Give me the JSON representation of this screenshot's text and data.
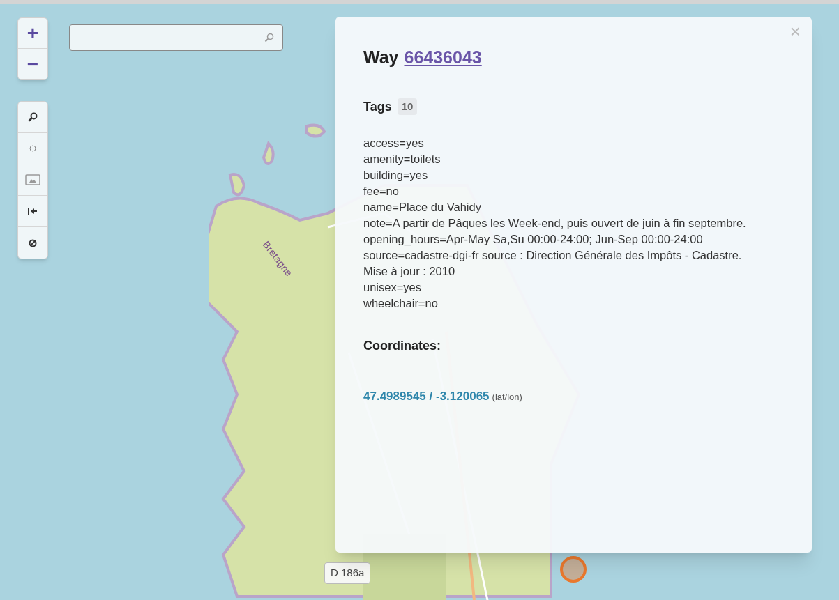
{
  "map": {
    "zoom_buttons": [
      "+",
      "−"
    ],
    "labels": [
      {
        "text": "Bretagne",
        "kind": "place"
      },
      {
        "text": "D 186a",
        "kind": "road"
      }
    ]
  },
  "popup": {
    "title": "Way",
    "id_link": "66436043",
    "close": "×",
    "tags_heading": "Tags",
    "tag_count": "10",
    "tags": [
      "access=yes",
      "amenity=toilets",
      "building=yes",
      "fee=no",
      "name=Place du Vahidy",
      "note=A partir de Pâques les Week-end, puis ouvert de juin à fin septembre.",
      "opening_hours=Apr-May Sa,Su 00:00-24:00; Jun-Sep 00:00-24:00",
      "source=cadastre-dgi-fr source : Direction Générale des Impôts - Cadastre. Mise à jour : 2010",
      "unisex=yes",
      "wheelchair=no"
    ],
    "coordinates_heading": "Coordinates:",
    "coordinates_link": "47.4989545 / -3.120065",
    "coordinates_suffix": "(lat/lon)"
  }
}
